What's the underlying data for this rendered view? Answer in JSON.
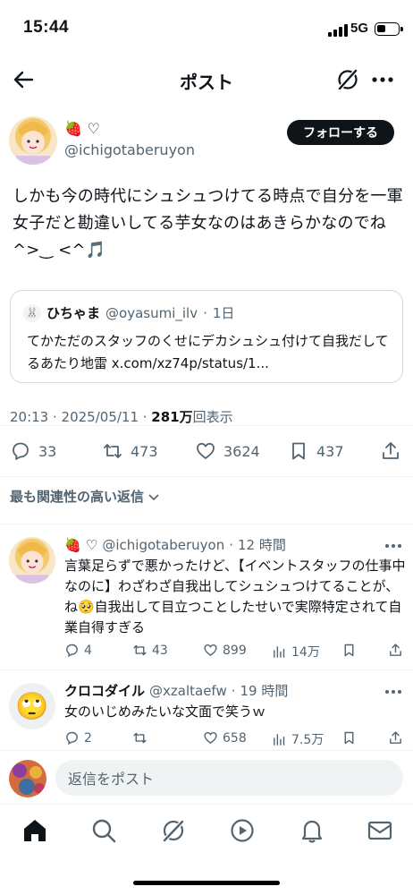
{
  "status_bar": {
    "time": "15:44",
    "network": "5G"
  },
  "nav": {
    "title": "ポスト"
  },
  "post": {
    "author_name": "🍓 ♡",
    "author_handle": "@ichigotaberuyon",
    "follow_label": "フォローする",
    "text": "しかも今の時代にシュシュつけてる時点で自分を一軍女子だと勘違いしてる芋女なのはあきらかなのでね^>‿ <^🎵",
    "quote": {
      "author_name": "ひちゃま",
      "author_handle": "@oyasumi_ilv",
      "age": "1日",
      "text": "てかただのスタッフのくせにデカシュシュ付けて自我だしてるあたり地雷 x.com/xz74p/status/1..."
    },
    "timestamp": "20:13 · 2025/05/11 · ",
    "views_value": "281万",
    "views_label": "回表示",
    "stats": {
      "replies": "33",
      "reposts": "473",
      "likes": "3624",
      "bookmarks": "437"
    }
  },
  "sort_label": "最も関連性の高い返信",
  "replies": [
    {
      "name": "🍓 ♡",
      "handle": "@ichigotaberuyon",
      "age": "12 時間",
      "text": "言葉足らずで悪かったけど、【イベントスタッフの仕事中なのに】わざわざ自我出してシュシュつけてることが、ね🥺自我出して目立つことしたせいで実際特定されて自業自得すぎる",
      "replies": "4",
      "reposts": "43",
      "likes": "899",
      "views": "14万"
    },
    {
      "name": "クロコダイル",
      "handle": "@xzaltaefw",
      "age": "19 時間",
      "avatar_emoji": "🙄",
      "text": "女のいじめみたいな文面で笑うｗ",
      "replies": "2",
      "reposts": "",
      "likes": "658",
      "views": "7.5万"
    }
  ],
  "composer": {
    "placeholder": "返信をポスト"
  },
  "colors": {
    "text": "#0f1419",
    "secondary": "#536471",
    "divider": "#eff3f4",
    "button": "#0f1419"
  },
  "icons": [
    "back-arrow-icon",
    "grok-icon",
    "more-icon",
    "reply-icon",
    "repost-icon",
    "like-icon",
    "bookmark-icon",
    "share-icon",
    "views-icon",
    "home-icon",
    "search-icon",
    "play-icon",
    "bell-icon",
    "mail-icon"
  ]
}
